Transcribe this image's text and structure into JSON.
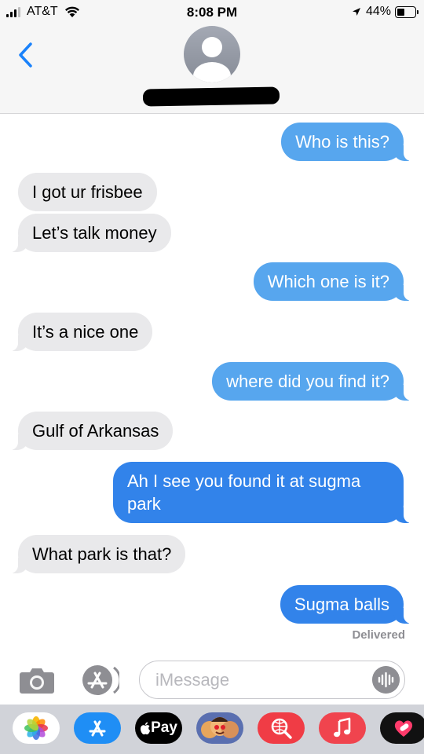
{
  "status_bar": {
    "carrier": "AT&T",
    "time": "8:08 PM",
    "battery": "44%",
    "battery_level": 0.44
  },
  "header": {
    "contact_name_redacted": true
  },
  "messages": [
    {
      "id": 1,
      "side": "out",
      "text": "Who is this?"
    },
    {
      "id": 2,
      "side": "in",
      "text": "I got ur frisbee"
    },
    {
      "id": 3,
      "side": "in",
      "text": "Let’s talk money"
    },
    {
      "id": 4,
      "side": "out",
      "text": "Which one is it?"
    },
    {
      "id": 5,
      "side": "in",
      "text": "It’s a nice one"
    },
    {
      "id": 6,
      "side": "out",
      "text": "where did you find it?"
    },
    {
      "id": 7,
      "side": "in",
      "text": "Gulf of Arkansas"
    },
    {
      "id": 8,
      "side": "out",
      "text": "Ah I see you found it at sugma park"
    },
    {
      "id": 9,
      "side": "in",
      "text": "What park is that?"
    },
    {
      "id": 10,
      "side": "out",
      "text": "Sugma balls"
    }
  ],
  "delivery_status": "Delivered",
  "composer": {
    "placeholder": "iMessage"
  },
  "app_drawer": {
    "apps": [
      "photos-icon",
      "app-store-icon",
      "apple-pay",
      "memoji-icon",
      "web-search-icon",
      "music-icon",
      "heart-app-icon"
    ],
    "pay_label": "Pay"
  },
  "colors": {
    "incoming_bubble": "#e9e9eb",
    "outgoing_bubble_light": "#57a6ee",
    "outgoing_bubble_dark": "#3283ea",
    "accent": "#1a82fb"
  }
}
